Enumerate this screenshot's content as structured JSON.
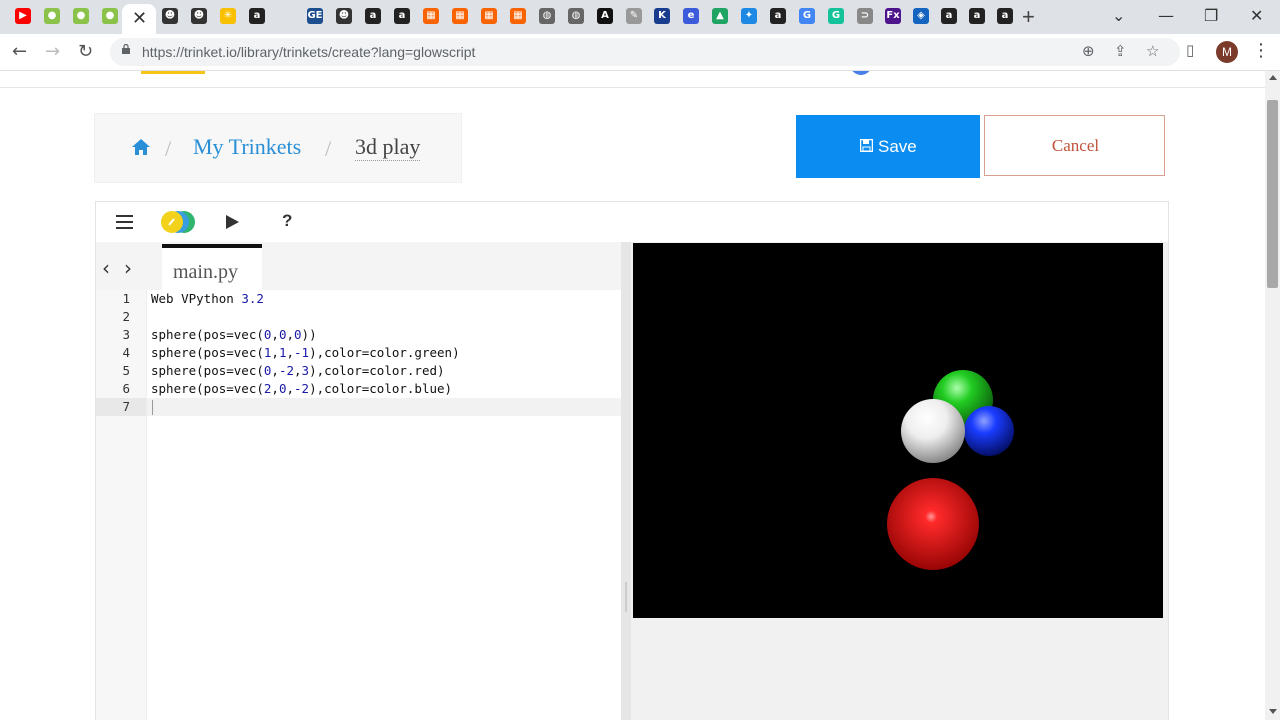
{
  "browser": {
    "tab_icons": [
      {
        "name": "youtube-icon",
        "color": "#ff0000",
        "glyph": "▶"
      },
      {
        "name": "glowscript-icon",
        "color": "#8bc34a",
        "glyph": "●"
      },
      {
        "name": "glowscript-icon",
        "color": "#8bc34a",
        "glyph": "●"
      },
      {
        "name": "glowscript-icon",
        "color": "#8bc34a",
        "glyph": "●"
      },
      {
        "name": "avatar-icon",
        "color": "#333333",
        "glyph": "☻"
      },
      {
        "name": "avatar-icon",
        "color": "#333333",
        "glyph": "☻"
      },
      {
        "name": "walmart-icon",
        "color": "#f9c000",
        "glyph": "✳"
      },
      {
        "name": "amazon-icon",
        "color": "#222222",
        "glyph": "a"
      },
      {
        "name": "blank-icon",
        "color": "#dee1e6",
        "glyph": ""
      },
      {
        "name": "ge-icon",
        "color": "#1c4e8f",
        "glyph": "GE"
      },
      {
        "name": "avatar-icon",
        "color": "#333333",
        "glyph": "☻"
      },
      {
        "name": "amazon-icon",
        "color": "#222222",
        "glyph": "a"
      },
      {
        "name": "amazon-icon",
        "color": "#222222",
        "glyph": "a"
      },
      {
        "name": "homedepot-icon",
        "color": "#f96302",
        "glyph": "▦"
      },
      {
        "name": "homedepot-icon",
        "color": "#f96302",
        "glyph": "▦"
      },
      {
        "name": "homedepot-icon",
        "color": "#f96302",
        "glyph": "▦"
      },
      {
        "name": "homedepot-icon",
        "color": "#f96302",
        "glyph": "▦"
      },
      {
        "name": "globe-icon",
        "color": "#666666",
        "glyph": "◍"
      },
      {
        "name": "globe-icon",
        "color": "#666666",
        "glyph": "◍"
      },
      {
        "name": "adobe-icon",
        "color": "#111111",
        "glyph": "A"
      },
      {
        "name": "pen-icon",
        "color": "#999999",
        "glyph": "✎"
      },
      {
        "name": "letter-icon",
        "color": "#1a3c8f",
        "glyph": "K"
      },
      {
        "name": "e-icon",
        "color": "#3b5bdb",
        "glyph": "e"
      },
      {
        "name": "drive-icon",
        "color": "#1fa463",
        "glyph": "▲"
      },
      {
        "name": "app-icon",
        "color": "#1e88e5",
        "glyph": "✦"
      },
      {
        "name": "amazon-icon",
        "color": "#222222",
        "glyph": "a"
      },
      {
        "name": "google-icon",
        "color": "#4285f4",
        "glyph": "G"
      },
      {
        "name": "grammarly-icon",
        "color": "#15c39a",
        "glyph": "G"
      },
      {
        "name": "arrow-icon",
        "color": "#888888",
        "glyph": "⊃"
      },
      {
        "name": "fedex-icon",
        "color": "#4d148c",
        "glyph": "Fx"
      },
      {
        "name": "drop-icon",
        "color": "#1565c0",
        "glyph": "◈"
      },
      {
        "name": "amazon-icon",
        "color": "#222222",
        "glyph": "a"
      },
      {
        "name": "amazon-icon",
        "color": "#222222",
        "glyph": "a"
      },
      {
        "name": "amazon-icon",
        "color": "#222222",
        "glyph": "a"
      }
    ],
    "url": "https://trinket.io/library/trinkets/create?lang=glowscript",
    "profile_initial": "M"
  },
  "page": {
    "breadcrumb": {
      "sep": "/",
      "my_trinkets": "My Trinkets",
      "trinket_name": "3d play"
    },
    "save_label": "Save",
    "cancel_label": "Cancel"
  },
  "editor": {
    "file_name": "main.py",
    "help_label": "?",
    "line_numbers": [
      "1",
      "2",
      "3",
      "4",
      "5",
      "6",
      "7"
    ],
    "code_lines": [
      "Web VPython 3.2",
      "",
      "sphere(pos=vec(0,0,0))",
      "sphere(pos=vec(1,1,-1),color=color.green)",
      "sphere(pos=vec(0,-2,3),color=color.red)",
      "sphere(pos=vec(2,0,-2),color=color.blue)",
      ""
    ]
  },
  "scene": {
    "background": "#000000",
    "spheres": [
      {
        "name": "green-sphere",
        "color": "#22cc22"
      },
      {
        "name": "blue-sphere",
        "color": "#1a3cff"
      },
      {
        "name": "white-sphere",
        "color": "#f4f4f4"
      },
      {
        "name": "red-sphere",
        "color": "#ee1111"
      }
    ]
  },
  "colors": {
    "save_bg": "#0a8cf0",
    "cancel_text": "#c0533a",
    "link": "#2a8fd6"
  }
}
